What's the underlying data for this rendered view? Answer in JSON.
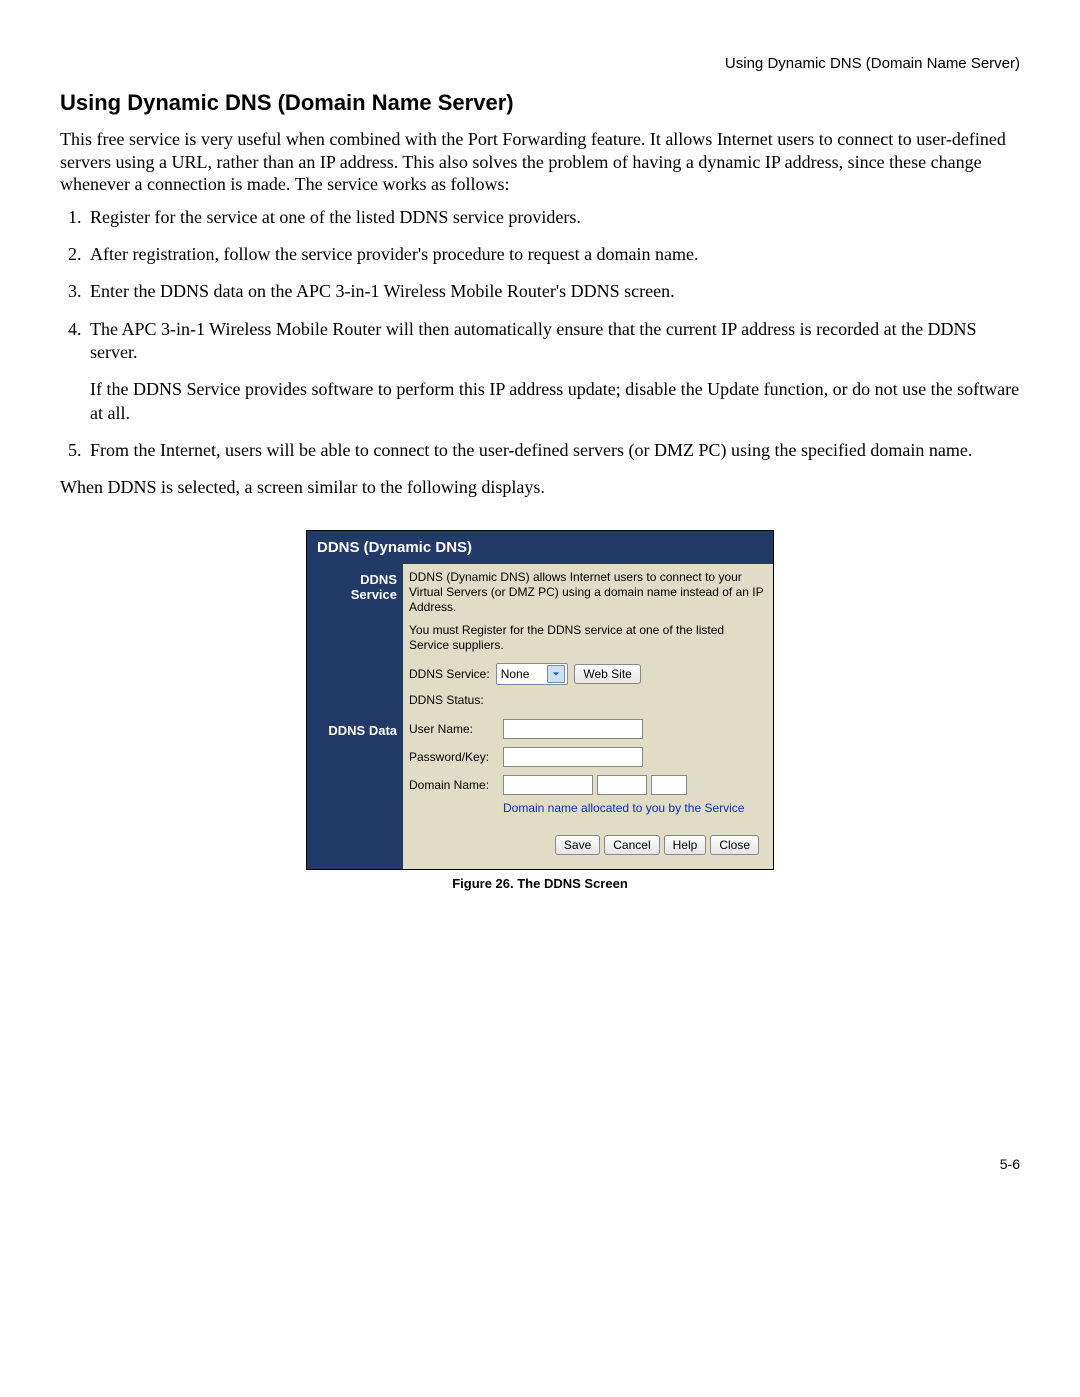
{
  "header": {
    "running_head": "Using Dynamic DNS (Domain Name Server)"
  },
  "title": "Using Dynamic DNS (Domain Name Server)",
  "intro": "This free service is very useful when combined with the Port Forwarding feature. It allows Internet users to connect to user-defined servers using a URL, rather than an IP address. This also solves the problem of having a dynamic IP address, since these change whenever a connection is made. The service works as follows:",
  "steps": [
    {
      "text": "Register for the service at one of the listed DDNS service providers."
    },
    {
      "text": "After registration, follow the service provider's procedure to request a domain name."
    },
    {
      "text": "Enter the DDNS data on the APC 3-in-1 Wireless Mobile Router's DDNS screen."
    },
    {
      "text": "The APC 3-in-1 Wireless Mobile Router will then automatically ensure that the current IP address is recorded at the DDNS server.",
      "note": "If the DDNS Service provides software to perform this IP address update; disable the Update function, or do not use the software at all."
    },
    {
      "text": "From the Internet, users will be able to connect to the user-defined servers (or DMZ PC) using the specified domain name."
    }
  ],
  "lead_in": "When DDNS is selected, a screen similar to the following displays.",
  "ddns_panel": {
    "title": "DDNS (Dynamic DNS)",
    "service": {
      "side_label": "DDNS Service",
      "desc1": "DDNS (Dynamic DNS) allows Internet users to connect to your Virtual Servers (or DMZ PC) using a domain name instead of an IP Address.",
      "desc2": "You must Register for the DDNS service at one of the listed Service suppliers.",
      "field_label": "DDNS Service:",
      "select_value": "None",
      "website_button": "Web Site",
      "status_label": "DDNS Status:"
    },
    "data": {
      "side_label": "DDNS Data",
      "user_label": "User Name:",
      "pass_label": "Password/Key:",
      "domain_label": "Domain Name:",
      "domain_hint": "Domain name allocated to you by the Service"
    },
    "buttons": {
      "save": "Save",
      "cancel": "Cancel",
      "help": "Help",
      "close": "Close"
    }
  },
  "figure_caption": "Figure 26. The DDNS Screen",
  "page_number": "5-6"
}
